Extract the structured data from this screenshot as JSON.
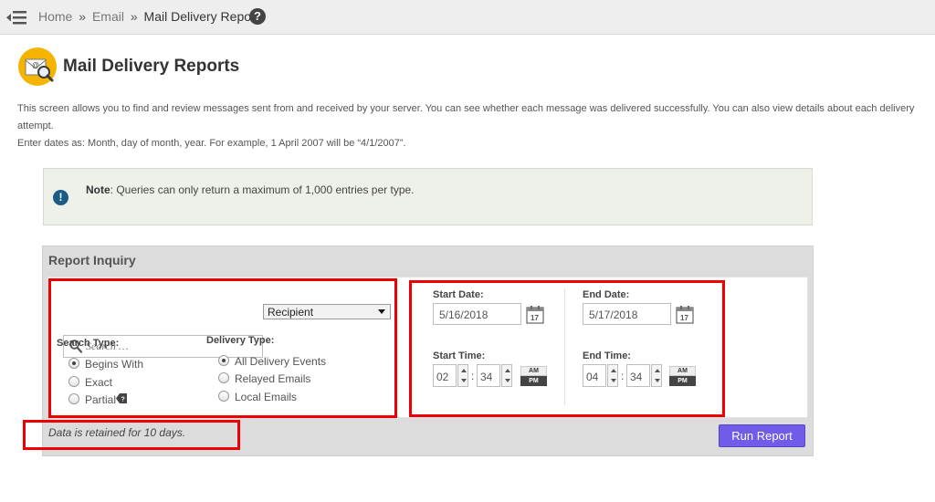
{
  "breadcrumb": {
    "home": "Home",
    "sep1": "»",
    "email": "Email",
    "sep2": "»",
    "current": "Mail Delivery Reports",
    "help": "?"
  },
  "page": {
    "title": "Mail Delivery Reports",
    "icon": "mail-search-icon"
  },
  "description": {
    "line1": "This screen allows you to find and review messages sent from and received by your server. You can see whether each message was delivered successfully. You can also view details about each delivery attempt.",
    "line2": "Enter dates as: Month, day of month, year. For example, 1 April 2007 will be “4/1/2007”."
  },
  "note": {
    "icon": "!",
    "label": "Note",
    "text": ": Queries can only return a maximum of 1,000 entries per type."
  },
  "report": {
    "heading": "Report Inquiry",
    "search_placeholder": "Search …",
    "field_select": "Recipient",
    "search_type_label": "Search Type:",
    "search_types": [
      "Begins With",
      "Exact",
      "Partial"
    ],
    "delivery_type_label": "Delivery Type:",
    "delivery_types": [
      "All Delivery Events",
      "Relayed Emails",
      "Local Emails"
    ],
    "start_date_label": "Start Date:",
    "start_date": "5/16/2018",
    "end_date_label": "End Date:",
    "end_date": "5/17/2018",
    "start_time_label": "Start Time:",
    "start_hour": "02",
    "start_minute": "34",
    "end_time_label": "End Time:",
    "end_hour": "04",
    "end_minute": "34",
    "colon": ":",
    "am": "AM",
    "pm": "PM",
    "retained_text": "Data is retained for 10 days.",
    "run_button": "Run Report"
  },
  "colors": {
    "accent": "#6f5ce8",
    "highlight": "#ee0000",
    "note_icon": "#1a5c86",
    "mail_icon": "#f5b400"
  }
}
